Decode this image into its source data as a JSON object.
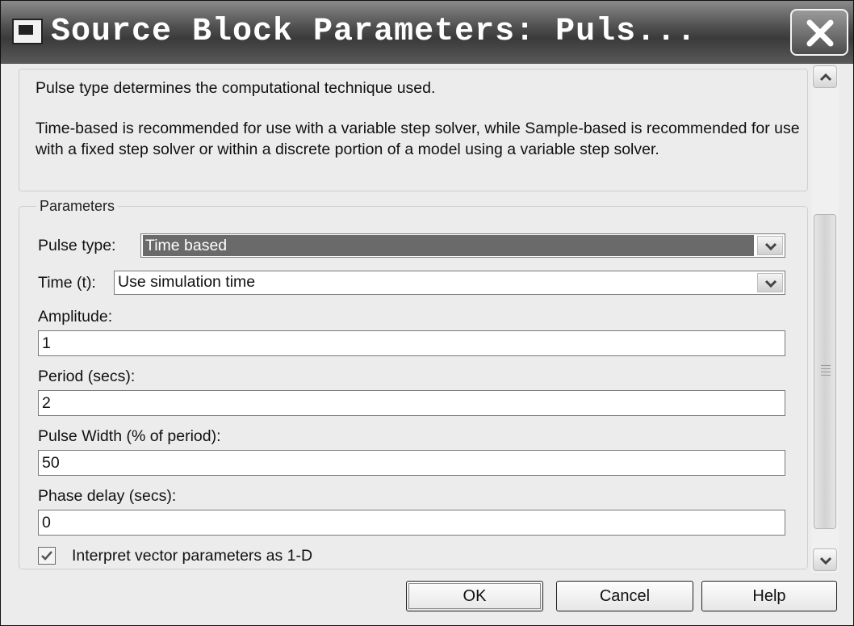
{
  "window": {
    "title": "Source Block Parameters: Puls...",
    "icon": "simulink-window-icon",
    "close_icon": "close-icon"
  },
  "description": {
    "line1": "Pulse type determines the computational technique used.",
    "line2": "Time-based is recommended for use with a variable step solver, while Sample-based is recommended for use with a fixed step solver or within a discrete portion of a model using a variable step solver."
  },
  "parameters": {
    "legend": "Parameters",
    "pulse_type_label": "Pulse type:",
    "pulse_type_value": "Time based",
    "time_label": "Time (t):",
    "time_value": "Use simulation time",
    "amplitude_label": "Amplitude:",
    "amplitude_value": "1",
    "period_label": "Period (secs):",
    "period_value": "2",
    "pulse_width_label": "Pulse Width (% of period):",
    "pulse_width_value": "50",
    "phase_delay_label": "Phase delay (secs):",
    "phase_delay_value": "0",
    "interpret_label": "Interpret vector parameters as 1-D",
    "interpret_checked": true
  },
  "buttons": {
    "ok": "OK",
    "cancel": "Cancel",
    "help": "Help"
  }
}
